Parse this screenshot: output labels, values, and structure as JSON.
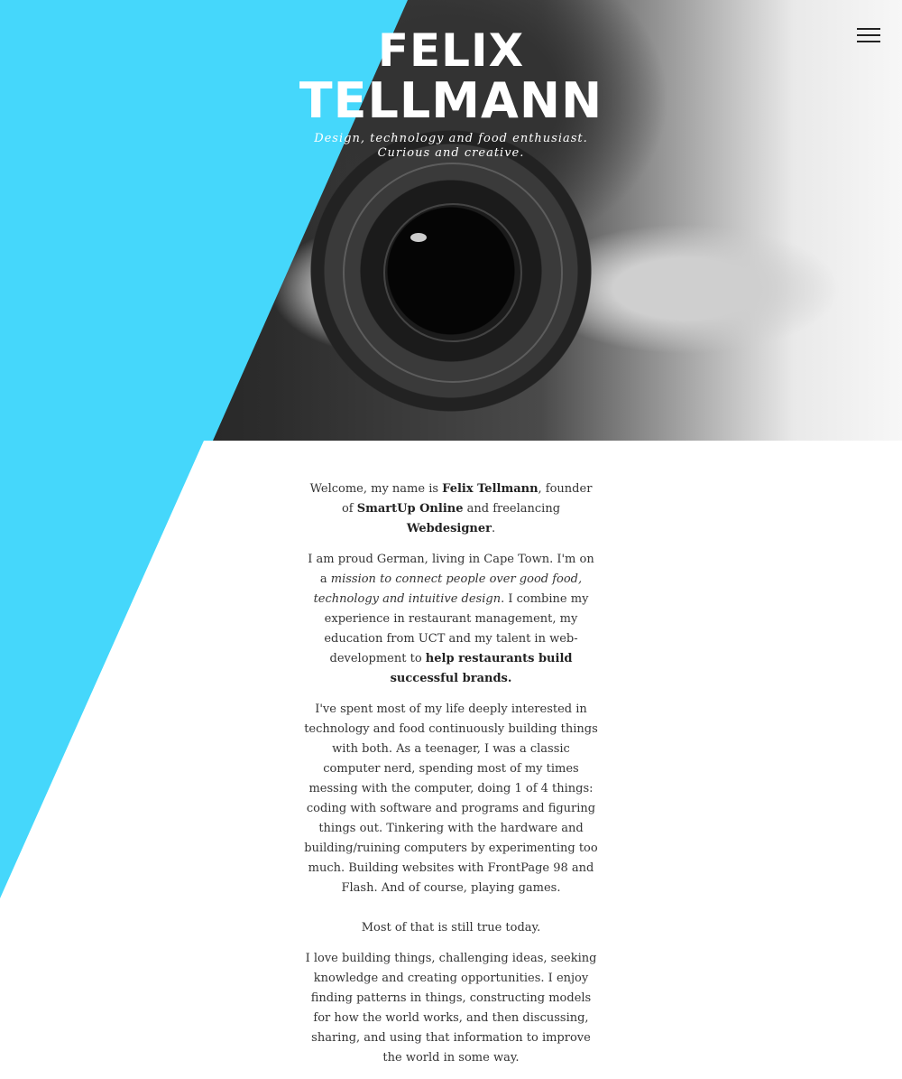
{
  "header": {
    "first_name": "FELIX",
    "last_name": "TELLMANN",
    "tagline_line1": "Design, technology and food enthusiast.",
    "tagline_line2": "Curious and creative.",
    "menu_icon": "hamburger-icon"
  },
  "colors": {
    "accent": "#45d7fb",
    "text": "#333333",
    "background": "#ffffff"
  },
  "about": {
    "p1": {
      "t1": "Welcome, my name is ",
      "b1": "Felix Tellmann",
      "t2": ", founder of ",
      "b2": "SmartUp Online",
      "t3": " and freelancing ",
      "b3": "Webdesigner",
      "t4": "."
    },
    "p2": {
      "t1": "I am proud German, living in Cape Town. I'm on a ",
      "i1": "mission to connect people over good food, technology and intuitive design",
      "t2": ". I combine my experience in restaurant management, my education from UCT and my talent in web-development to ",
      "b1": "help restaurants build successful brands."
    },
    "p3": "I've spent most of my life deeply interested in technology and food continuously building things with both. As a teenager, I was a classic computer nerd, spending most of my times messing with the computer, doing 1 of 4 things: coding with software and programs and figuring things out. Tinkering with the hardware and building/ruining computers by experimenting too much. Building websites with FrontPage 98 and Flash. And of course, playing games.",
    "p4": "Most of that is still true today.",
    "p5": "I love building things, challenging ideas, seeking knowledge and creating opportunities. I enjoy finding patterns in things, constructing models for how the world works, and then discussing, sharing, and using that information to improve the world in some way."
  }
}
